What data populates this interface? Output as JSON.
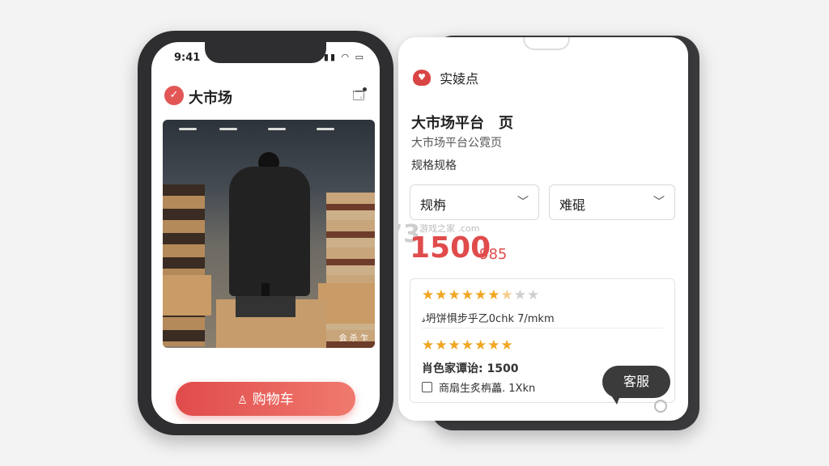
{
  "left_phone": {
    "status_time": "9:41",
    "status_icons": "▮▮ ◠ ▭",
    "app_title": "大市场",
    "logo_glyph": "✓",
    "cart_icon": "cart-icon",
    "photo_caption": "会 杀 乍",
    "cart_button_label": "购物车",
    "cart_button_icon": "♙"
  },
  "right_phone": {
    "brand_name": "实婈点",
    "detail_title": "大市场平台　页",
    "detail_subtitle": "大市场平台公霓页",
    "spec_label": "规格规格",
    "select_1": "规栴",
    "select_2": "难䃂",
    "watermark": "K73",
    "watermark_sub": "游戏之家\n.com",
    "price_main": "1500",
    "price_secondary": "985",
    "reviews": {
      "rating_1": 6.5,
      "line_1": "𝓈坍饼惧步乎乙0chk 7/mkm",
      "rating_2": 7,
      "line_2": "肖色家谭诒: 1500",
      "line_3": "商扇生炙栴藟. 1Xkn"
    },
    "support_label": "客服"
  },
  "colors": {
    "accent_red": "#e04b4b",
    "star_gold": "#f0a623",
    "dark_frame": "#2e2e30"
  }
}
